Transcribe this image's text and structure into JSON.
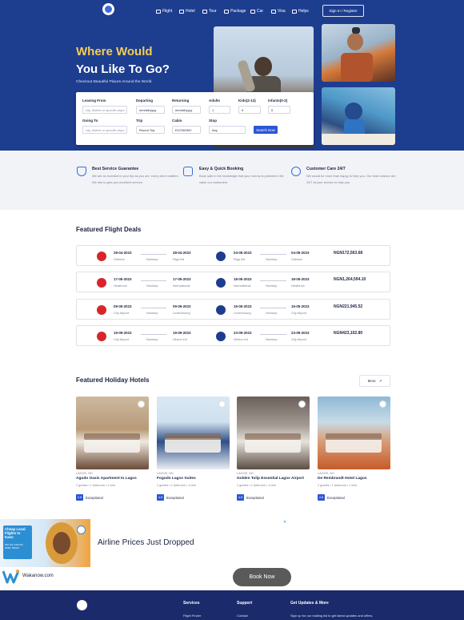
{
  "colors": {
    "hero": "#1d3d8f",
    "accent": "#2d55d6",
    "gold": "#f5cd55",
    "footer": "#1b2a6b",
    "band": "#f1f3f6"
  },
  "nav": {
    "items": [
      {
        "label": "Flight",
        "icon": "plane-icon"
      },
      {
        "label": "Hotel",
        "icon": "bed-icon"
      },
      {
        "label": "Tour",
        "icon": "tour-icon"
      },
      {
        "label": "Package",
        "icon": "package-icon"
      },
      {
        "label": "Car",
        "icon": "car-icon"
      },
      {
        "label": "Visa",
        "icon": "visa-icon"
      },
      {
        "label": "Helps",
        "icon": "help-icon"
      }
    ],
    "signin": "Sign In / Register"
  },
  "hero": {
    "title_line1": "Where Would",
    "title_line2": "You Like To Go?",
    "subtitle": "Checkout Beautiful Places Around the World."
  },
  "search": {
    "leaving_label": "Leaving From",
    "leaving_placeholder": "city, district or specific airpo",
    "departing_label": "Departing",
    "departing_value": "mm/dd/yyyy",
    "returning_label": "Returning",
    "returning_value": "mm/dd/yyyy",
    "adults_label": "Adults",
    "adults_value": "1",
    "kids_label": "Kids(2-12)",
    "kids_value": "0",
    "infants_label": "Infants(0-2)",
    "infants_value": "0",
    "going_label": "Going To",
    "going_placeholder": "city, district or specific airpo",
    "trip_label": "Trip",
    "trip_value": "Round Trip",
    "cabin_label": "Cabin",
    "cabin_value": "ECONOMY",
    "stop_label": "Stop",
    "stop_value": "Any",
    "button": "Search Now"
  },
  "features": [
    {
      "title": "Best Service Guarantee",
      "desc": "We are as invested in your trip as you are, every client matters. We aim to give you excellent service.",
      "icon": "shield-icon"
    },
    {
      "title": "Easy & Quick Booking",
      "desc": "Book safe in the knowledge that your money is protected. We value our customers.",
      "icon": "card-icon"
    },
    {
      "title": "Customer Care 24/7",
      "desc": "We would be more than happy to help you. Our team advisor are 24/7 at your service to help you.",
      "icon": "support-icon"
    }
  ],
  "flights_title": "Featured Flight Deals",
  "flights": [
    {
      "d1": "28-04-2023",
      "c1": "Gatwick",
      "stop1": "Nonstop",
      "d2": "28-04-2023",
      "c2": "Riga Intl",
      "d3": "04-05-2023",
      "c3": "Riga Intl",
      "stop2": "Nonstop",
      "d4": "04-05-2023",
      "c4": "Gatwick",
      "price": "NGN172,563.68"
    },
    {
      "d1": "17-05-2023",
      "c1": "Heathrow",
      "stop1": "Nonstop",
      "d2": "17-05-2023",
      "c2": "International",
      "d3": "18-05-2023",
      "c3": "International",
      "stop2": "Nonstop",
      "d4": "18-05-2023",
      "c4": "Heathrow",
      "price": "NGN1,264,594.10"
    },
    {
      "d1": "09-05-2023",
      "c1": "City Airport",
      "stop1": "Nonstop",
      "d2": "09-05-2023",
      "c2": "Luxembourg",
      "d3": "16-05-2023",
      "c3": "Luxembourg",
      "stop2": "Nonstop",
      "d4": "16-05-2023",
      "c4": "City Airport",
      "price": "NGN221,945.52"
    },
    {
      "d1": "19-09-2023",
      "c1": "City Airport",
      "stop1": "Nonstop",
      "d2": "19-09-2023",
      "c2": "Vilnius Intl",
      "d3": "23-09-2023",
      "c3": "Vilnius Intl",
      "stop2": "Nonstop",
      "d4": "23-09-2023",
      "c4": "City Airport",
      "price": "NGN423,102.80"
    }
  ],
  "hotels_title": "Featured Holiday Hotels",
  "more_label": "More",
  "hotels": [
    {
      "loc": "LAGOS, NG",
      "name": "Agudo Oasis Apartment In Lagos",
      "meta": "2 guests  •  1 bedroom  •  1 bed",
      "rating": "4.8",
      "rating_label": "Exceptional"
    },
    {
      "loc": "LAGOS, NG",
      "name": "Fogodo Lagos Suites",
      "meta": "2 guests  •  1 bedroom  •  1 bed",
      "rating": "4.8",
      "rating_label": "Exceptional"
    },
    {
      "loc": "LAGOS, NG",
      "name": "Golden Tulip Essential Lagos Airport",
      "meta": "2 guests  •  1 bedroom  •  1 bed",
      "rating": "4.8",
      "rating_label": "Exceptional"
    },
    {
      "loc": "LAGOS, NG",
      "name": "De Rembrandt Hotel Lagos",
      "meta": "2 guests  •  1 bedroom  •  1 bed",
      "rating": "4.8",
      "rating_label": "Exceptional"
    }
  ],
  "ad": {
    "promo_line1": "Cheap Local",
    "promo_line2": "Flights to",
    "promo_line3": "Kano",
    "promo_line4": "PAY AS LOW AS",
    "promo_line5": "N55K TODAY",
    "title": "Airline Prices Just Dropped",
    "brand": "Wakanow.com",
    "button": "Book Now"
  },
  "footer": {
    "col1": "Services",
    "col1_item": "Flight Finder",
    "col2": "Support",
    "col2_item": "Contact",
    "col3": "Get Updates & More",
    "col3_item": "Sign up for our mailing list to get latest updates and offers."
  }
}
